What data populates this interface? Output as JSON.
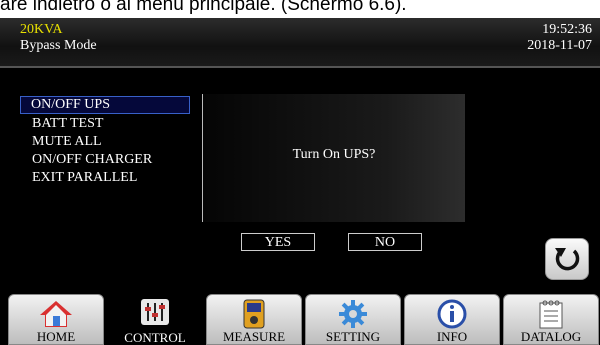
{
  "caption_text": "are indietro o al menu principale. (Schermo 6.6).",
  "header": {
    "model": "20KVA",
    "mode": "Bypass Mode",
    "time": "19:52:36",
    "date": "2018-11-07"
  },
  "menu": {
    "items": [
      {
        "label": "ON/OFF UPS",
        "selected": true
      },
      {
        "label": "BATT TEST"
      },
      {
        "label": "MUTE ALL"
      },
      {
        "label": "ON/OFF CHARGER"
      },
      {
        "label": "EXIT PARALLEL"
      }
    ]
  },
  "dialog": {
    "message": "Turn On UPS?",
    "yes_label": "YES",
    "no_label": "NO"
  },
  "tabs": [
    {
      "label": "HOME",
      "icon": "home-icon"
    },
    {
      "label": "CONTROL",
      "icon": "sliders-icon",
      "active": true
    },
    {
      "label": "MEASURE",
      "icon": "meter-icon"
    },
    {
      "label": "SETTING",
      "icon": "gear-icon"
    },
    {
      "label": "INFO",
      "icon": "info-icon"
    },
    {
      "label": "DATALOG",
      "icon": "notepad-icon"
    }
  ],
  "colors": {
    "model_text": "#e8e000",
    "selection_border": "#3860c8",
    "background": "#000000"
  }
}
